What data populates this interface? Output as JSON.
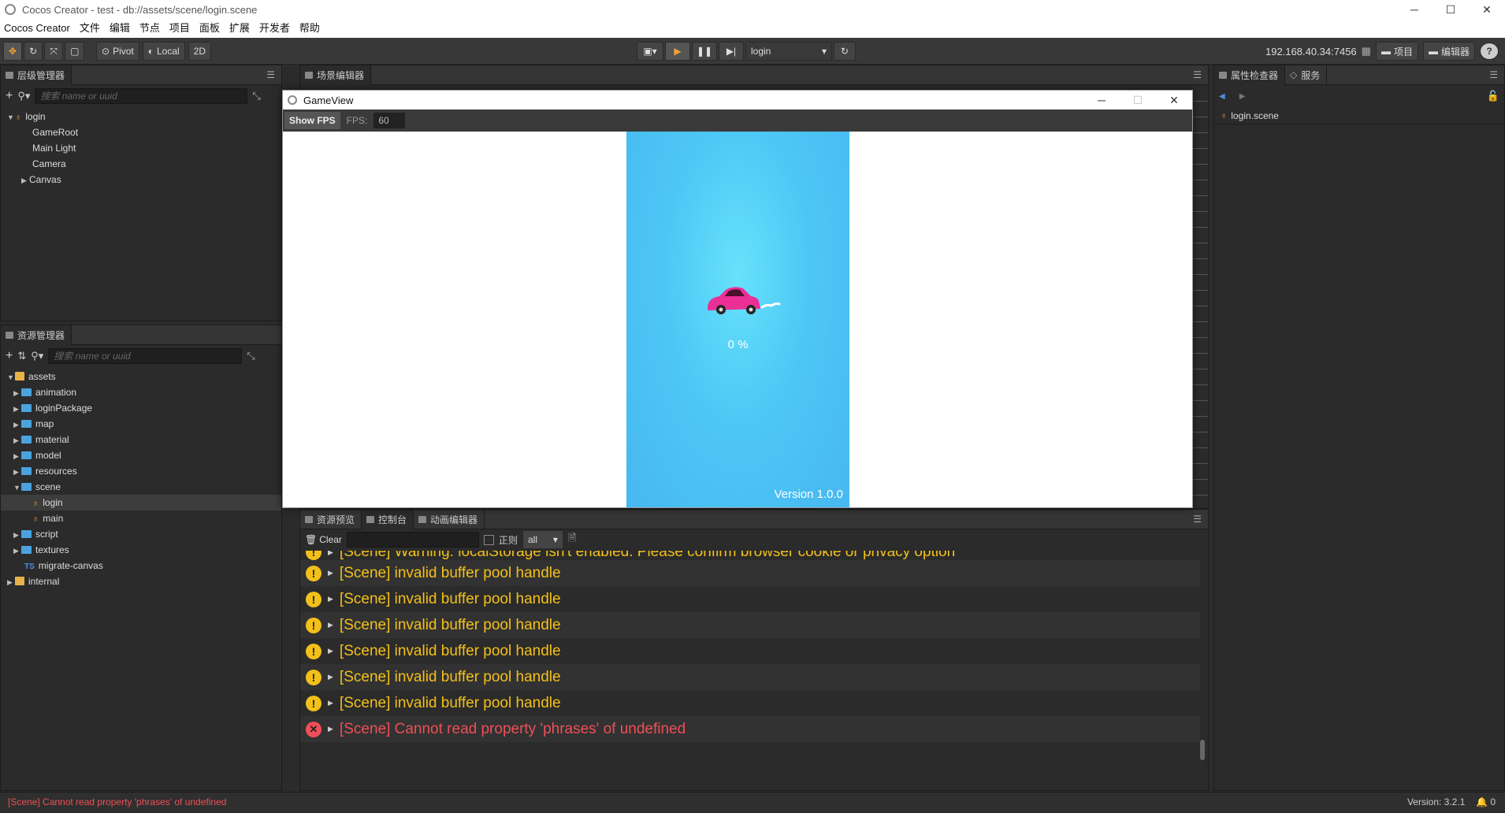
{
  "window": {
    "title": "Cocos Creator - test - db://assets/scene/login.scene",
    "min": "─",
    "max": "☐",
    "close": "✕"
  },
  "menu": [
    "Cocos Creator",
    "文件",
    "编辑",
    "节点",
    "项目",
    "面板",
    "扩展",
    "开发者",
    "帮助"
  ],
  "toolbar": {
    "pivot_label": "Pivot",
    "local_label": "Local",
    "mode_2d_label": "2D",
    "scene_select_value": "login",
    "ip_address": "192.168.40.34:7456",
    "project_label": "项目",
    "editor_label": "编辑器",
    "help": "?"
  },
  "hierarchy": {
    "tab_label": "层级管理器",
    "search_placeholder": "搜索 name or uuid",
    "root": "login",
    "children": [
      "GameRoot",
      "Main Light",
      "Camera",
      "Canvas"
    ]
  },
  "assets": {
    "tab_label": "资源管理器",
    "search_placeholder": "搜索 name or uuid",
    "root": "assets",
    "folders_top": [
      "animation",
      "loginPackage",
      "map",
      "material",
      "model",
      "resources"
    ],
    "scene_folder": "scene",
    "scene_children": [
      "login",
      "main"
    ],
    "folders_bottom": [
      "script",
      "textures"
    ],
    "ts_file": "migrate-canvas",
    "ts_badge": "TS",
    "internal": "internal"
  },
  "scene_editor": {
    "tab_label": "场景编辑器"
  },
  "gameview": {
    "title": "GameView",
    "show_fps_label": "Show FPS",
    "fps_label": "FPS:",
    "fps_value": "60",
    "progress_text": "0 %",
    "progress_value": 0,
    "version_text": "Version 1.0.0",
    "colors": {
      "sky": "#4dc7f5",
      "car": "#ec2f95"
    }
  },
  "bottom_tabs": [
    "资源预览",
    "控制台",
    "动画编辑器"
  ],
  "console": {
    "clear_label": "Clear",
    "regex_label": "正则",
    "level_value": "all",
    "logs": [
      {
        "level": "warn",
        "text": "[Scene] Warning: localStorage isn't enabled. Please confirm browser cookie or privacy option"
      },
      {
        "level": "warn",
        "text": "[Scene] invalid buffer pool handle"
      },
      {
        "level": "warn",
        "text": "[Scene] invalid buffer pool handle"
      },
      {
        "level": "warn",
        "text": "[Scene] invalid buffer pool handle"
      },
      {
        "level": "warn",
        "text": "[Scene] invalid buffer pool handle"
      },
      {
        "level": "warn",
        "text": "[Scene] invalid buffer pool handle"
      },
      {
        "level": "warn",
        "text": "[Scene] invalid buffer pool handle"
      },
      {
        "level": "error",
        "text": "[Scene] Cannot read property 'phrases' of undefined"
      }
    ],
    "warn_icon": "!",
    "error_icon": "✕",
    "colors": {
      "warn": "#f3c019",
      "error": "#ef4f56"
    }
  },
  "inspector": {
    "tab_label": "属性检查器",
    "service_tab_label": "服务",
    "file_name": "login.scene"
  },
  "status": {
    "error_message": "[Scene] Cannot read property 'phrases' of undefined",
    "version": "Version: 3.2.1",
    "notifications": "0"
  }
}
